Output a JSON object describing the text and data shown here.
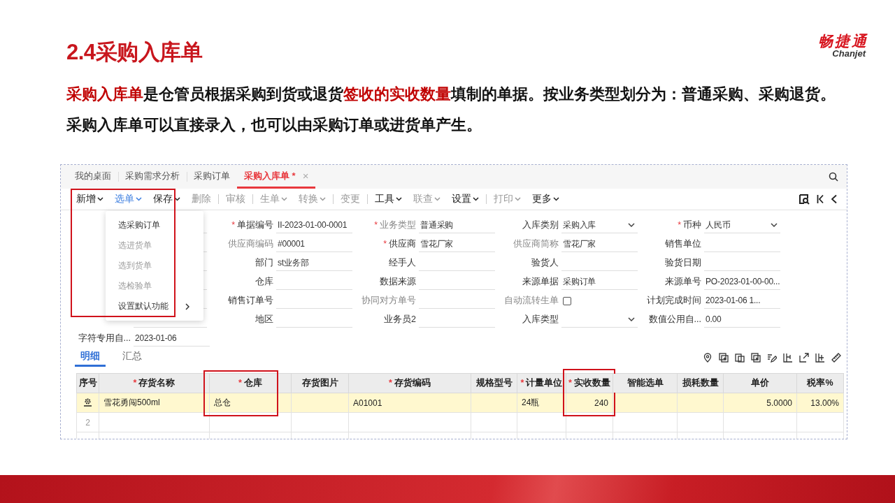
{
  "slide": {
    "title": "2.4采购入库单",
    "logo": {
      "name": "畅捷通",
      "subtitle": "Chanjet"
    },
    "description": [
      {
        "text": "采购入库单",
        "highlight": true
      },
      {
        "text": "是仓管员根据采购到货或退货",
        "highlight": false
      },
      {
        "text": "签收的实收数量",
        "highlight": true
      },
      {
        "text": "填制的单据。按业务类型划分为：普通采购、采购退货。采购入库单可以直接录入，也可以由采购订单或进货单产生。",
        "highlight": false
      }
    ]
  },
  "app": {
    "tabs": [
      {
        "label": "我的桌面",
        "selected": false
      },
      {
        "label": "采购需求分析",
        "selected": false
      },
      {
        "label": "采购订单",
        "selected": false
      },
      {
        "label": "采购入库单 *",
        "selected": true,
        "close": "×"
      }
    ],
    "toolbar": [
      {
        "label": "新增",
        "dropdown": true,
        "disabled": false,
        "open": false,
        "divider_before": false
      },
      {
        "label": "选单",
        "dropdown": true,
        "disabled": false,
        "open": true,
        "divider_before": false
      },
      {
        "label": "保存",
        "dropdown": true,
        "disabled": false,
        "open": false,
        "divider_before": false
      },
      {
        "label": "删除",
        "dropdown": false,
        "disabled": true,
        "open": false,
        "divider_before": false
      },
      {
        "label": "审核",
        "dropdown": false,
        "disabled": true,
        "open": false,
        "divider_before": true
      },
      {
        "label": "生单",
        "dropdown": true,
        "disabled": true,
        "open": false,
        "divider_before": true
      },
      {
        "label": "转换",
        "dropdown": true,
        "disabled": true,
        "open": false,
        "divider_before": false
      },
      {
        "label": "变更",
        "dropdown": false,
        "disabled": true,
        "open": false,
        "divider_before": true
      },
      {
        "label": "工具",
        "dropdown": true,
        "disabled": false,
        "open": false,
        "divider_before": true
      },
      {
        "label": "联查",
        "dropdown": true,
        "disabled": true,
        "open": false,
        "divider_before": false
      },
      {
        "label": "设置",
        "dropdown": true,
        "disabled": false,
        "open": false,
        "divider_before": false
      },
      {
        "label": "打印",
        "dropdown": true,
        "disabled": true,
        "open": false,
        "divider_before": true
      },
      {
        "label": "更多",
        "dropdown": true,
        "disabled": false,
        "open": false,
        "divider_before": false
      }
    ],
    "menu": {
      "callout": true,
      "items": [
        {
          "label": "选采购订单",
          "disabled": false,
          "submenu": false
        },
        {
          "label": "选进货单",
          "disabled": true,
          "submenu": false
        },
        {
          "label": "选到货单",
          "disabled": true,
          "submenu": false
        },
        {
          "label": "选检验单",
          "disabled": true,
          "submenu": false
        },
        {
          "label": "设置默认功能",
          "disabled": false,
          "submenu": true
        }
      ]
    },
    "form": {
      "rows": [
        {
          "fields": [
            {
              "label": "单据编号",
              "value": "II-2023-01-00-0001",
              "required_mark": "*",
              "muted": false,
              "kind": "text"
            },
            {
              "label": "业务类型",
              "value": "普通采购",
              "required_mark": "*",
              "muted": true,
              "kind": "text"
            },
            {
              "label": "入库类别",
              "value": "采购入库",
              "muted": false,
              "kind": "select"
            },
            {
              "label": "币种",
              "value": "人民币",
              "required_mark": "*",
              "muted": false,
              "kind": "select"
            }
          ]
        },
        {
          "fields": [
            {
              "label": "供应商编码",
              "value": "#00001",
              "muted": true,
              "kind": "text"
            },
            {
              "label": "供应商",
              "value": "雪花厂家",
              "required_mark": "*",
              "muted": false,
              "kind": "text"
            },
            {
              "label": "供应商简称",
              "value": "雪花厂家",
              "muted": true,
              "kind": "text"
            },
            {
              "label": "销售单位",
              "muted": false,
              "kind": "text"
            }
          ]
        },
        {
          "fields": [
            {
              "label": "部门",
              "value": "st业务部",
              "muted": false,
              "kind": "text"
            },
            {
              "label": "经手人",
              "muted": false,
              "kind": "text"
            },
            {
              "label": "验货人",
              "muted": false,
              "kind": "text"
            },
            {
              "label": "验货日期",
              "muted": false,
              "kind": "text"
            }
          ]
        },
        {
          "fields": [
            {
              "label": "仓库",
              "muted": false,
              "kind": "text"
            },
            {
              "label": "数据来源",
              "muted": false,
              "kind": "text"
            },
            {
              "label": "来源单据",
              "value": "采购订单",
              "muted": false,
              "kind": "text"
            },
            {
              "label": "来源单号",
              "value": "PO-2023-01-00-00...",
              "muted": false,
              "kind": "text"
            }
          ]
        },
        {
          "fields": [
            {
              "label": "销售订单号",
              "muted": false,
              "kind": "text"
            },
            {
              "label": "协同对方单号",
              "muted": true,
              "kind": "text"
            },
            {
              "label": "自动流转生单",
              "muted": true,
              "kind": "checkbox",
              "checked": false
            },
            {
              "label": "计划完成时间",
              "value": "2023-01-06 1...",
              "muted": false,
              "kind": "text"
            }
          ]
        },
        {
          "fields": [
            {
              "label": "地区",
              "muted": false,
              "kind": "text"
            },
            {
              "label": "业务员2",
              "muted": false,
              "kind": "text"
            },
            {
              "label": "入库类型",
              "muted": false,
              "kind": "select"
            },
            {
              "label": "数值公用自...",
              "value": "0.00",
              "muted": false,
              "kind": "text"
            }
          ]
        },
        {
          "fields": [
            {
              "label": "字符专用自...",
              "value": "2023-01-06",
              "muted": false,
              "kind": "text"
            }
          ]
        }
      ]
    },
    "detail_tabs": [
      {
        "label": "明细",
        "selected": true
      },
      {
        "label": "汇总",
        "selected": false
      }
    ],
    "table": {
      "columns": [
        {
          "label": "序号",
          "callout": false
        },
        {
          "label": "存货名称",
          "required_mark": "*",
          "callout": false
        },
        {
          "label": "仓库",
          "required_mark": "*",
          "callout": true
        },
        {
          "label": "存货图片",
          "callout": false
        },
        {
          "label": "存货编码",
          "required_mark": "*",
          "callout": false
        },
        {
          "label": "规格型号",
          "callout": false
        },
        {
          "label": "计量单位",
          "required_mark": "*",
          "callout": false
        },
        {
          "label": "实收数量",
          "required_mark": "*",
          "numeric": true,
          "callout": true
        },
        {
          "label": "智能选单",
          "callout": false
        },
        {
          "label": "损耗数量",
          "callout": false
        },
        {
          "label": "单价",
          "numeric": true,
          "callout": false
        },
        {
          "label": "税率%",
          "numeric": true,
          "callout": false
        }
      ],
      "rows": [
        {
          "selected": true,
          "cells": [
            "",
            "雪花勇闯500ml",
            "总仓",
            "",
            "A01001",
            "",
            "24瓶",
            "240",
            "",
            "",
            "5.0000",
            "13.00%"
          ]
        },
        {
          "selected": false,
          "cells": [
            "2",
            "",
            "",
            "",
            "",
            "",
            "",
            "",
            "",
            "",
            "",
            ""
          ]
        }
      ]
    }
  }
}
